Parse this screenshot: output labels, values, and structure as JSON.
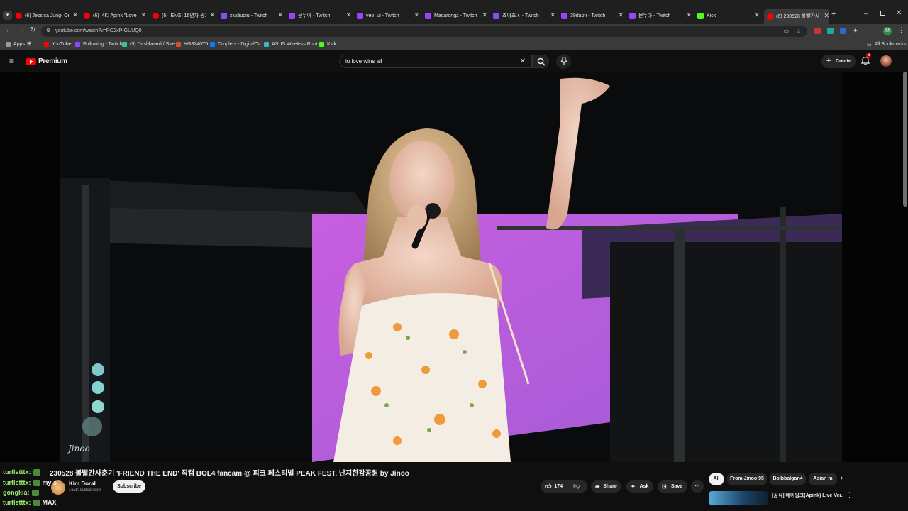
{
  "browser": {
    "tabs": [
      {
        "title": "(6) Jessica Jung- Onto",
        "color": "#ff0000"
      },
      {
        "title": "(6) [4K] Apink \"Love m",
        "color": "#ff0000"
      },
      {
        "title": "(6) [ENG] 16년차 광기",
        "color": "#ff0000"
      },
      {
        "title": "xiudiudiu - Twitch",
        "color": "#9146ff"
      },
      {
        "title": "문두아 - Twitch",
        "color": "#9146ff"
      },
      {
        "title": "yeo_ul - Twitch",
        "color": "#9146ff"
      },
      {
        "title": "Macarongz - Twitch",
        "color": "#9146ff"
      },
      {
        "title": "쵸이쵸ㅅ - Twitch",
        "color": "#9146ff"
      },
      {
        "title": "39daph - Twitch",
        "color": "#9146ff"
      },
      {
        "title": "문두아 - Twitch",
        "color": "#9146ff"
      },
      {
        "title": "Kick",
        "color": "#53fc18"
      },
      {
        "title": "(6) 230528 볼빨간사",
        "color": "#ff0000"
      }
    ],
    "url": "youtube.com/watch?v=RO2xP-GUUQ0",
    "bookmarks": [
      {
        "label": "Apps",
        "icon": "apps-grid-icon"
      },
      {
        "label": "YouTube",
        "icon": "youtube-icon"
      },
      {
        "label": "Following - Twitch",
        "icon": "twitch-icon"
      },
      {
        "label": "(5) Dashboard / Stre...",
        "icon": "streamlabs-icon"
      },
      {
        "label": "HG8240T5",
        "icon": "router-icon"
      },
      {
        "label": "Droplets - DigitalOc...",
        "icon": "digitalocean-icon"
      },
      {
        "label": "ASUS Wireless Rout...",
        "icon": "asus-icon"
      },
      {
        "label": "Kick",
        "icon": "kick-icon"
      }
    ],
    "all_bookmarks": "All Bookmarks",
    "notification_count": "6"
  },
  "youtube": {
    "logo_text": "Premium",
    "search_query": "iu love wins all",
    "create_label": "Create",
    "notifications": "6",
    "video_title": "230528 볼빨간사춘기 'FRIEND THE END' 직캠 BOL4 fancam @ 피크 페스티벌 PEAK FEST. 난지한강공원 by Jinoo",
    "channel_name": "Kim Doral",
    "subscribers": "165K subscribers",
    "subscribe_label": "Subscribe",
    "likes": "174",
    "share_label": "Share",
    "ask_label": "Ask",
    "save_label": "Save",
    "watermark": "Jinoo",
    "chips": [
      "All",
      "From Jinoo 95",
      "Bolbbalgan4",
      "Asian m"
    ],
    "next_video_title": "[공식] 에이핑크(Apink) Live Ver."
  },
  "chat": [
    {
      "user": "turtletttx:",
      "msg": ""
    },
    {
      "user": "turtletttx:",
      "msg": "my s"
    },
    {
      "user": "gongkia:",
      "msg": ""
    },
    {
      "user": "turtletttx:",
      "msg": "MAX"
    }
  ],
  "colors": {
    "accent": "#ff0000",
    "twitch": "#9146ff",
    "kick": "#53fc18",
    "chat_user": "#9bef6c"
  }
}
